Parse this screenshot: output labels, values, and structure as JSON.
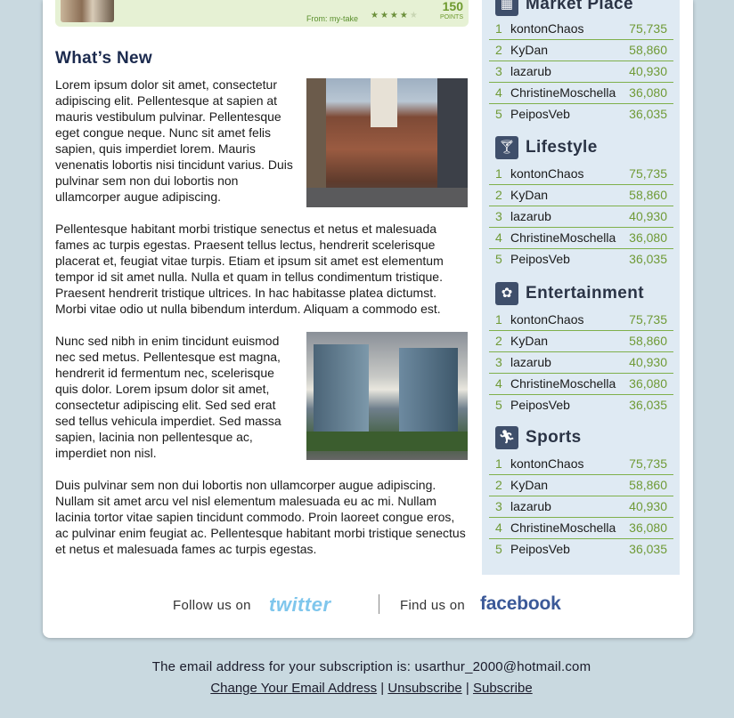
{
  "promo": {
    "from": "From: my-take",
    "rating": 4,
    "points": "150",
    "points_label": "POINTS"
  },
  "article": {
    "title": "What’s New",
    "paragraphs": [
      "Lorem ipsum dolor sit amet, consectetur adipiscing elit. Pellentesque at sapien at mauris vestibulum pulvinar. Pellentesque eget congue neque. Nunc sit amet felis sapien, quis imperdiet lorem. Mauris venenatis lobortis nisi tincidunt varius. Duis pulvinar sem non dui lobortis non ullamcorper augue adipiscing.",
      "Pellentesque habitant morbi tristique senectus et netus et malesuada fames ac turpis egestas. Praesent tellus lectus, hendrerit scelerisque placerat et, feugiat vitae turpis. Etiam et ipsum sit amet est elementum tempor id sit amet nulla. Nulla et quam in tellus condimentum tristique. Praesent hendrerit tristique ultrices. In hac habitasse platea dictumst. Morbi vitae odio ut nulla bibendum interdum. Aliquam a commodo est.",
      "Nunc sed nibh in enim tincidunt euismod nec sed metus. Pellentesque est magna, hendrerit id fermentum nec, scelerisque quis dolor. Lorem ipsum dolor sit amet, consectetur adipiscing elit. Sed sed erat sed tellus vehicula imperdiet. Sed massa sapien, lacinia non pellentesque ac, imperdiet non nisl.",
      "Duis pulvinar sem non dui lobortis non ullamcorper augue adipiscing. Nullam sit amet arcu vel nisl elementum malesuada eu ac mi. Nullam lacinia tortor vitae sapien tincidunt commodo. Proin laoreet congue eros, ac pulvinar enim feugiat ac. Pellentesque habitant morbi tristique senectus et netus et malesuada fames ac turpis egestas."
    ]
  },
  "social": {
    "follow_text": "Follow us on",
    "twitter_logo": "twitter",
    "find_text": "Find us on",
    "facebook_logo": "facebook"
  },
  "sidebar": {
    "categories": [
      {
        "title": "Market Place",
        "icon": "chart-icon",
        "rows": [
          {
            "rank": "1",
            "name": "kontonChaos",
            "score": "75,735"
          },
          {
            "rank": "2",
            "name": "KyDan",
            "score": "58,860"
          },
          {
            "rank": "3",
            "name": "lazarub",
            "score": "40,930"
          },
          {
            "rank": "4",
            "name": "ChristineMoschella",
            "score": "36,080"
          },
          {
            "rank": "5",
            "name": "PeiposVeb",
            "score": "36,035"
          }
        ]
      },
      {
        "title": "Lifestyle",
        "icon": "cocktail-icon",
        "rows": [
          {
            "rank": "1",
            "name": "kontonChaos",
            "score": "75,735"
          },
          {
            "rank": "2",
            "name": "KyDan",
            "score": "58,860"
          },
          {
            "rank": "3",
            "name": "lazarub",
            "score": "40,930"
          },
          {
            "rank": "4",
            "name": "ChristineMoschella",
            "score": "36,080"
          },
          {
            "rank": "5",
            "name": "PeiposVeb",
            "score": "36,035"
          }
        ]
      },
      {
        "title": "Entertainment",
        "icon": "popcorn-icon",
        "rows": [
          {
            "rank": "1",
            "name": "kontonChaos",
            "score": "75,735"
          },
          {
            "rank": "2",
            "name": "KyDan",
            "score": "58,860"
          },
          {
            "rank": "3",
            "name": "lazarub",
            "score": "40,930"
          },
          {
            "rank": "4",
            "name": "ChristineMoschella",
            "score": "36,080"
          },
          {
            "rank": "5",
            "name": "PeiposVeb",
            "score": "36,035"
          }
        ]
      },
      {
        "title": "Sports",
        "icon": "runner-icon",
        "rows": [
          {
            "rank": "1",
            "name": "kontonChaos",
            "score": "75,735"
          },
          {
            "rank": "2",
            "name": "KyDan",
            "score": "58,860"
          },
          {
            "rank": "3",
            "name": "lazarub",
            "score": "40,930"
          },
          {
            "rank": "4",
            "name": "ChristineMoschella",
            "score": "36,080"
          },
          {
            "rank": "5",
            "name": "PeiposVeb",
            "score": "36,035"
          }
        ]
      }
    ]
  },
  "footer": {
    "notice": "The email address for your subscription is: usarthur_2000@hotmail.com",
    "change_email": "Change Your Email Address",
    "separator": "|",
    "unsubscribe": "Unsubscribe",
    "subscribe": "Subscribe"
  }
}
